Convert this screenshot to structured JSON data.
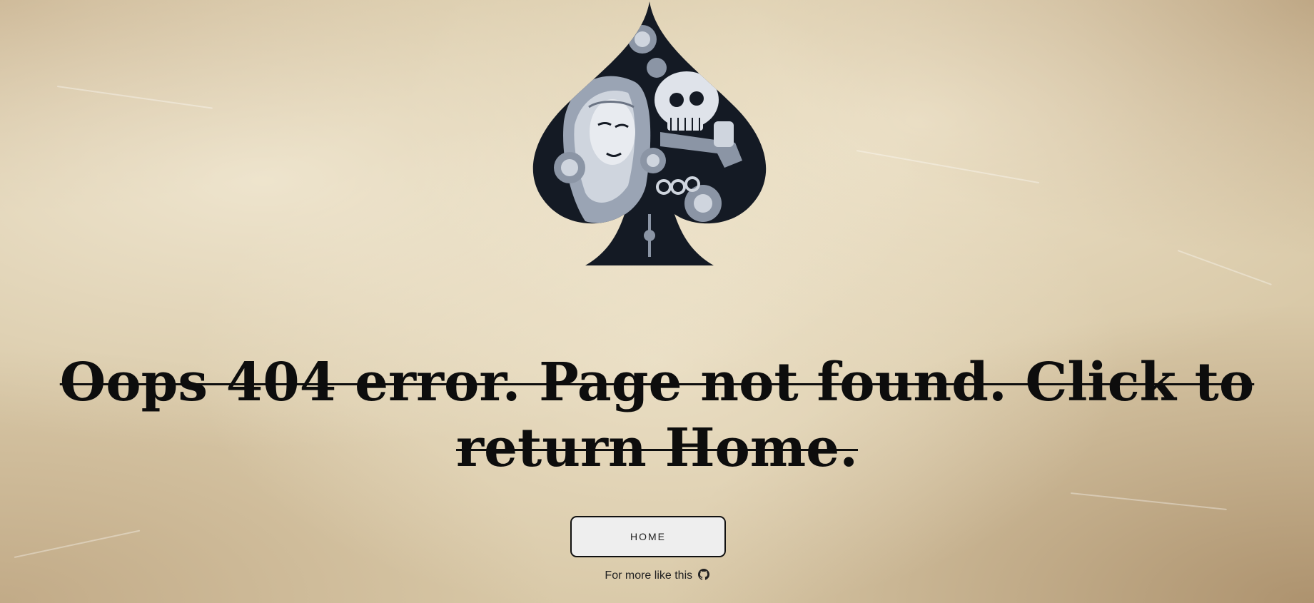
{
  "headline": {
    "text": "Oops 404 error. Page not found. Click to return Home."
  },
  "home_button": {
    "label": "HOME"
  },
  "footer": {
    "text": "For more like this",
    "icon": "github-icon"
  },
  "logo": {
    "icon": "spade-skull-tattoo-logo"
  },
  "colors": {
    "background": "#d9c9a8",
    "text": "#0d0d0d",
    "button_bg": "#eeeeee",
    "button_border": "#111111"
  }
}
